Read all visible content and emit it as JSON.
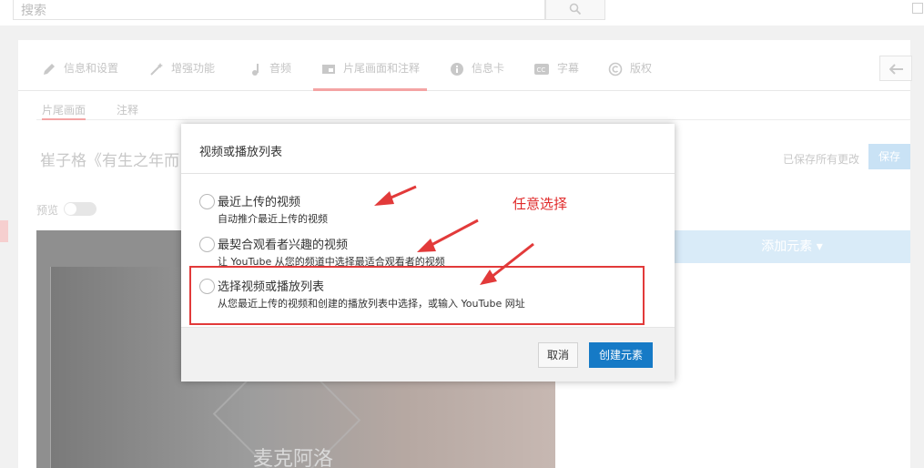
{
  "search": {
    "placeholder": "搜索"
  },
  "tabs": [
    {
      "label": "信息和设置",
      "icon": "pencil-icon"
    },
    {
      "label": "增强功能",
      "icon": "magic-wand-icon"
    },
    {
      "label": "音频",
      "icon": "music-note-icon"
    },
    {
      "label": "片尾画面和注释",
      "icon": "end-screen-icon"
    },
    {
      "label": "信息卡",
      "icon": "info-icon"
    },
    {
      "label": "字幕",
      "icon": "cc-icon"
    },
    {
      "label": "版权",
      "icon": "copyright-icon"
    }
  ],
  "subtabs": [
    "片尾画面",
    "注释"
  ],
  "video": {
    "title": "崔子格《有生之年而",
    "caption": "麦克阿洛"
  },
  "status": {
    "saved": "已保存所有更改",
    "save_button": "保存"
  },
  "preview_label": "预览",
  "add_element": "添加元素 ▾",
  "dialog": {
    "title": "视频或播放列表",
    "options": [
      {
        "label": "最近上传的视频",
        "desc": "自动推介最近上传的视频"
      },
      {
        "label": "最契合观看者兴趣的视频",
        "desc": "让 YouTube 从您的频道中选择最适合观看者的视频"
      },
      {
        "label": "选择视频或播放列表",
        "desc": "从您最近上传的视频和创建的播放列表中选择，或输入 YouTube 网址"
      }
    ],
    "cancel": "取消",
    "create": "创建元素"
  },
  "annotation": {
    "text": "任意选择",
    "color": "#e02a2a"
  },
  "colors": {
    "accent_blue": "#167ac6",
    "tab_underline": "#f4a4a4"
  }
}
